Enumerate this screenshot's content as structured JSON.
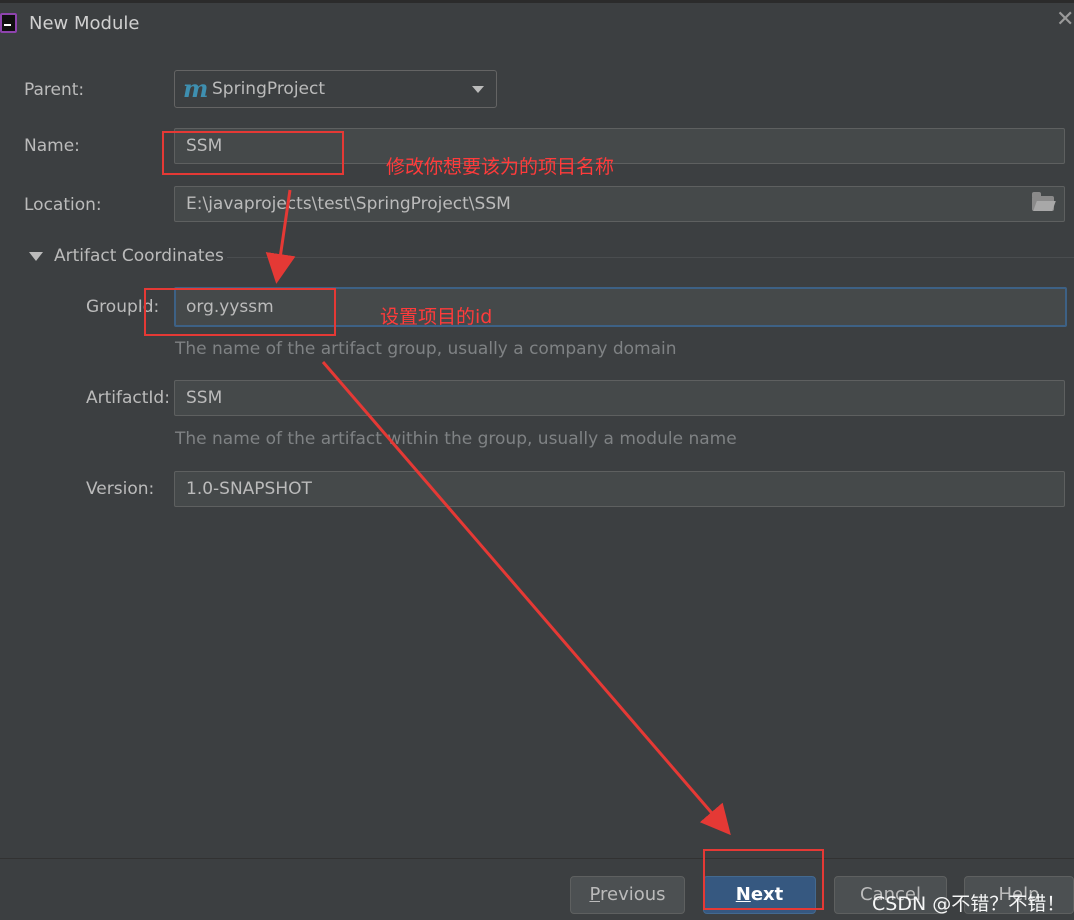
{
  "window": {
    "title": "New Module"
  },
  "form": {
    "parent_label": "Parent:",
    "parent_value": "SpringProject",
    "name_label": "Name:",
    "name_value": "SSM",
    "location_label": "Location:",
    "location_value": "E:\\javaprojects\\test\\SpringProject\\SSM",
    "section_title": "Artifact Coordinates",
    "groupid_label": "GroupId:",
    "groupid_value": "org.yyssm",
    "groupid_hint": "The name of the artifact group, usually a company domain",
    "artifactid_label": "ArtifactId:",
    "artifactid_value": "SSM",
    "artifactid_hint": "The name of the artifact within the group, usually a module name",
    "version_label": "Version:",
    "version_value": "1.0-SNAPSHOT"
  },
  "buttons": {
    "previous_mn": "P",
    "previous_rest": "revious",
    "next_mn": "N",
    "next_rest": "ext",
    "cancel": "Cancel",
    "help": "Help"
  },
  "annotations": {
    "name_note": "修改你想要该为的项目名称",
    "groupid_note": "设置项目的id"
  },
  "watermark": "CSDN @不错？不错！",
  "colors": {
    "background": "#3c3f41",
    "field": "#45494a",
    "focus_border": "#3d6185",
    "primary_button": "#365880",
    "annotation_red": "#e53935"
  }
}
